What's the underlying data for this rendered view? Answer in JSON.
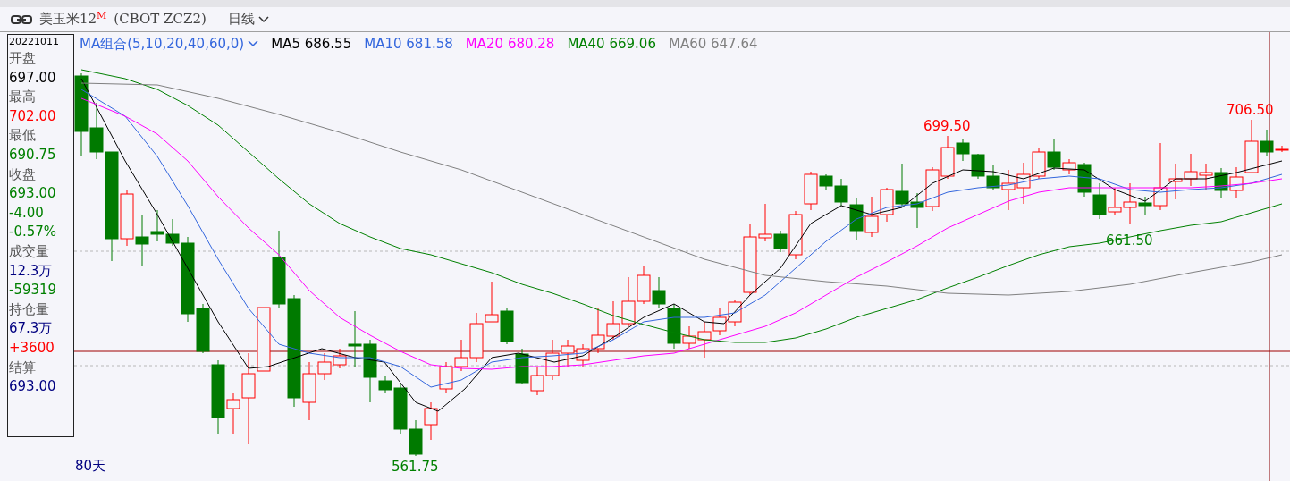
{
  "header": {
    "title": "美玉米12",
    "title_mark": "M",
    "code": "(CBOT ZCZ2)",
    "period": "日线"
  },
  "info_panel": {
    "date": "20221011",
    "items": [
      {
        "kind": "label",
        "text": "开盘"
      },
      {
        "kind": "value",
        "text": "697.00",
        "color": "#000000"
      },
      {
        "kind": "label",
        "text": "最高"
      },
      {
        "kind": "value",
        "text": "702.00",
        "color": "#ff0000"
      },
      {
        "kind": "label",
        "text": "最低"
      },
      {
        "kind": "value",
        "text": "690.75",
        "color": "#008000"
      },
      {
        "kind": "label",
        "text": "收盘"
      },
      {
        "kind": "value",
        "text": "693.00",
        "color": "#008000"
      },
      {
        "kind": "value",
        "text": "-4.00",
        "color": "#008000"
      },
      {
        "kind": "value",
        "text": "-0.57%",
        "color": "#008000"
      },
      {
        "kind": "label",
        "text": "成交量"
      },
      {
        "kind": "value",
        "text": "12.3万",
        "color": "#000080"
      },
      {
        "kind": "value",
        "text": "-59319",
        "color": "#008000"
      },
      {
        "kind": "label",
        "text": "持仓量"
      },
      {
        "kind": "value",
        "text": "67.3万",
        "color": "#000080"
      },
      {
        "kind": "value",
        "text": "+3600",
        "color": "#ff0000"
      },
      {
        "kind": "label",
        "text": "结算"
      },
      {
        "kind": "value",
        "text": "693.00",
        "color": "#000080"
      }
    ]
  },
  "legend": {
    "selector": "MA组合(5,10,20,40,60,0)",
    "lines": [
      {
        "name": "MA5",
        "value": "686.55",
        "color": "#000000"
      },
      {
        "name": "MA10",
        "value": "681.58",
        "color": "#3366dd"
      },
      {
        "name": "MA20",
        "value": "680.28",
        "color": "#ff00ff"
      },
      {
        "name": "MA40",
        "value": "669.06",
        "color": "#008000"
      },
      {
        "name": "MA60",
        "value": "647.64",
        "color": "#808080"
      }
    ]
  },
  "annotations": [
    {
      "text": "699.50",
      "color": "#ff0000"
    },
    {
      "text": "706.50",
      "color": "#ff0000"
    },
    {
      "text": "661.50",
      "color": "#008000"
    },
    {
      "text": "561.75",
      "color": "#008000"
    }
  ],
  "range_label": "80天"
}
